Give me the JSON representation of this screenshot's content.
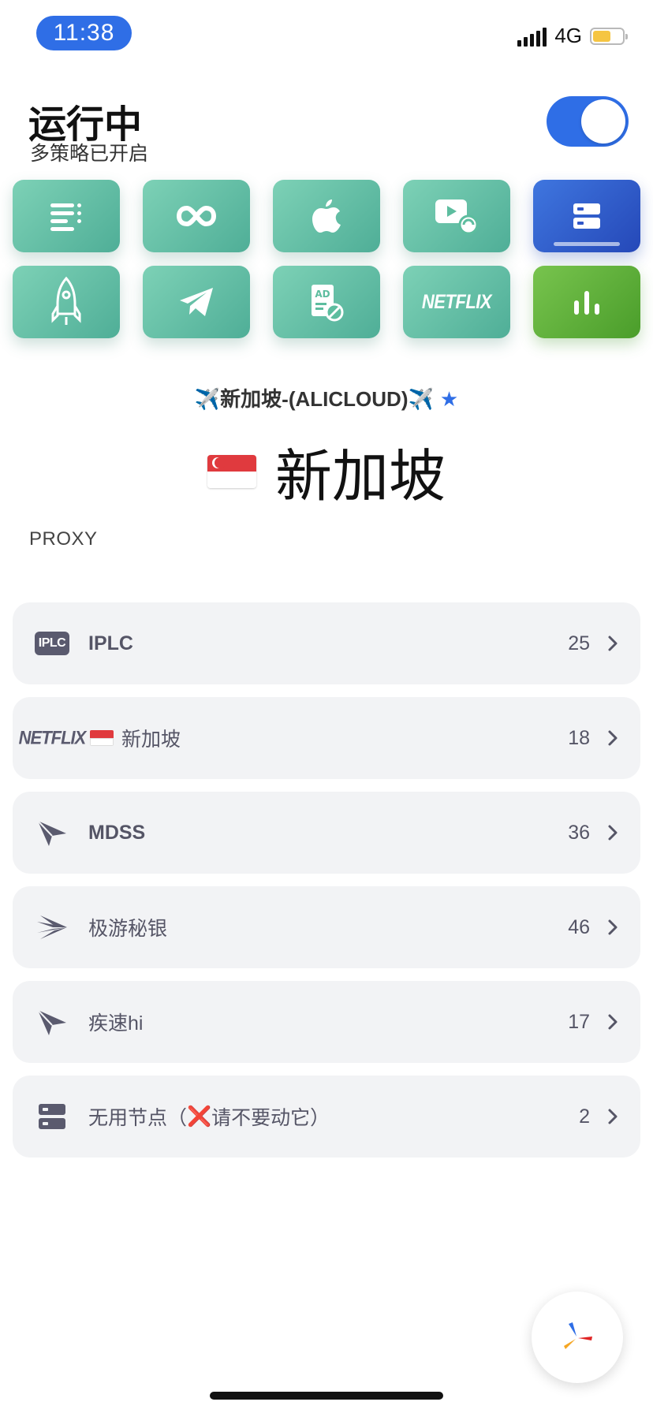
{
  "status_bar": {
    "time": "11:38",
    "network": "4G"
  },
  "header": {
    "title": "运行中",
    "subtitle": "多策略已开启"
  },
  "tiles": [
    {
      "icon": "list-icon"
    },
    {
      "icon": "infinity-icon"
    },
    {
      "icon": "apple-icon"
    },
    {
      "icon": "video-icon"
    },
    {
      "icon": "server-icon",
      "active": true
    },
    {
      "icon": "rocket-icon"
    },
    {
      "icon": "telegram-icon"
    },
    {
      "icon": "adblock-icon",
      "text": "AD"
    },
    {
      "icon": "netflix-icon",
      "text": "NETFLIX"
    },
    {
      "icon": "chart-icon"
    }
  ],
  "selection": {
    "line": "✈️新加坡-(ALICLOUD)✈️",
    "star": "★",
    "name": "新加坡"
  },
  "section": {
    "label": "PROXY"
  },
  "groups": [
    {
      "badge": "IPLC",
      "label": "IPLC",
      "count": "25"
    },
    {
      "badge": "NETFLIX",
      "label": "新加坡",
      "count": "18"
    },
    {
      "label": "MDSS",
      "count": "36"
    },
    {
      "label": "极游秘银",
      "count": "46"
    },
    {
      "label": "疾速hi",
      "count": "17"
    },
    {
      "label_a": "无用节点（",
      "label_x": "❌",
      "label_b": "请不要动它）",
      "count": "2"
    }
  ],
  "colors": {
    "accent": "#2f6ee6",
    "tile": "#5dbd9f",
    "row_bg": "#f2f3f5"
  }
}
